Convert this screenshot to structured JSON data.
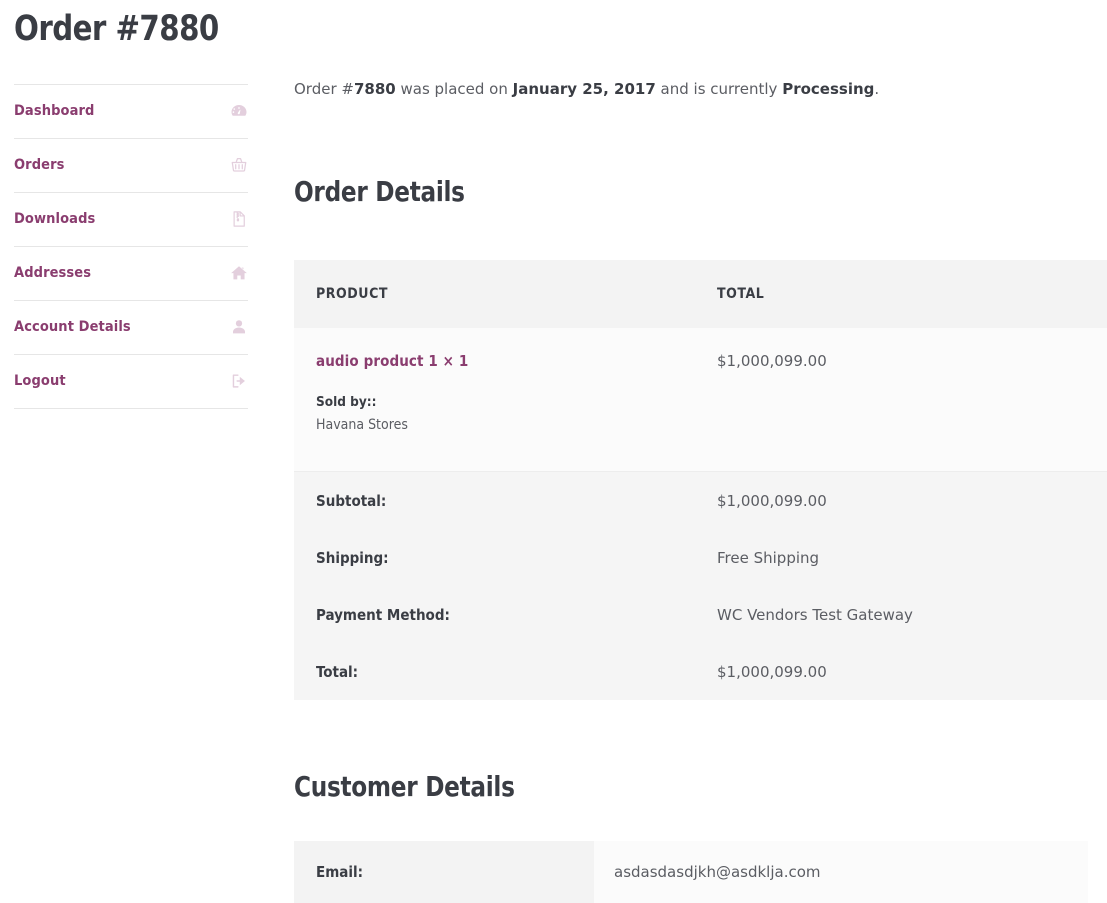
{
  "page": {
    "title": "Order #7880"
  },
  "sidebar": {
    "items": [
      {
        "label": "Dashboard",
        "icon": "dashboard-icon"
      },
      {
        "label": "Orders",
        "icon": "shopping-basket-icon"
      },
      {
        "label": "Downloads",
        "icon": "file-archive-icon"
      },
      {
        "label": "Addresses",
        "icon": "home-icon"
      },
      {
        "label": "Account Details",
        "icon": "user-icon"
      },
      {
        "label": "Logout",
        "icon": "sign-out-icon"
      }
    ]
  },
  "intro": {
    "prefix": "Order #",
    "order_number": "7880",
    "middle": " was placed on ",
    "date": "January 25, 2017",
    "connector": " and is currently ",
    "status": "Processing",
    "suffix": "."
  },
  "order_details": {
    "heading": "Order Details",
    "columns": {
      "product": "PRODUCT",
      "total": "TOTAL"
    },
    "items": [
      {
        "name": "audio product 1",
        "quantity_separator": "×",
        "quantity": "1",
        "sold_by_label": "Sold by::",
        "sold_by_value": "Havana Stores",
        "total": "$1,000,099.00"
      }
    ],
    "summary": [
      {
        "label": "Subtotal:",
        "value": "$1,000,099.00"
      },
      {
        "label": "Shipping:",
        "value": "Free Shipping"
      },
      {
        "label": "Payment Method:",
        "value": "WC Vendors Test Gateway"
      },
      {
        "label": "Total:",
        "value": "$1,000,099.00"
      }
    ]
  },
  "customer_details": {
    "heading": "Customer Details",
    "rows": [
      {
        "label": "Email:",
        "value": "asdasdasdjkh@asdklja.com"
      }
    ]
  },
  "colors": {
    "link": "#8a3d6f",
    "heading": "#3a3d44",
    "body_text": "#5b5d63",
    "table_header_bg": "#f3f3f3",
    "table_row_bg": "#fbfbfb",
    "table_footer_bg": "#f5f5f5",
    "divider": "#e6e6e6",
    "icon": "#e3cfdd"
  }
}
